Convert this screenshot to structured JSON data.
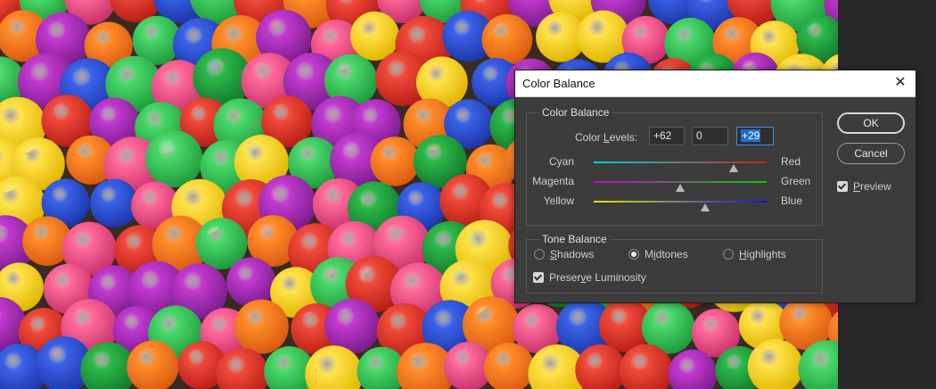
{
  "dialog": {
    "title": "Color Balance",
    "close_icon": "close-icon"
  },
  "color_balance": {
    "group_label": "Color Balance",
    "levels_label_pre": "Color ",
    "levels_label_u": "L",
    "levels_label_post": "evels:",
    "level1": "+62",
    "level2": "0",
    "level3": "+29",
    "sliders": [
      {
        "left": "Cyan",
        "right": "Red",
        "value": 62,
        "gradient": [
          "#00d0d0",
          "#d02020"
        ]
      },
      {
        "left": "Magenta",
        "right": "Green",
        "value": 0,
        "gradient": [
          "#d000d0",
          "#00d000"
        ]
      },
      {
        "left": "Yellow",
        "right": "Blue",
        "value": 29,
        "gradient": [
          "#e8e800",
          "#1010e0"
        ]
      }
    ]
  },
  "tone_balance": {
    "group_label": "Tone Balance",
    "shadows": {
      "u": "S",
      "rest": "hadows"
    },
    "midtones": {
      "pre": "M",
      "u": "i",
      "rest": "dtones"
    },
    "highlights": {
      "u": "H",
      "rest": "ighlights"
    },
    "preserve": {
      "pre": "Preser",
      "u": "v",
      "rest": "e Luminosity"
    },
    "selected": "Midtones",
    "preserve_checked": true
  },
  "buttons": {
    "ok": "OK",
    "cancel": "Cancel",
    "preview": {
      "u": "P",
      "rest": "review"
    },
    "preview_checked": true
  },
  "colors": {
    "dialog_bg": "#3c3c3c",
    "accent": "#1e6fd0"
  }
}
